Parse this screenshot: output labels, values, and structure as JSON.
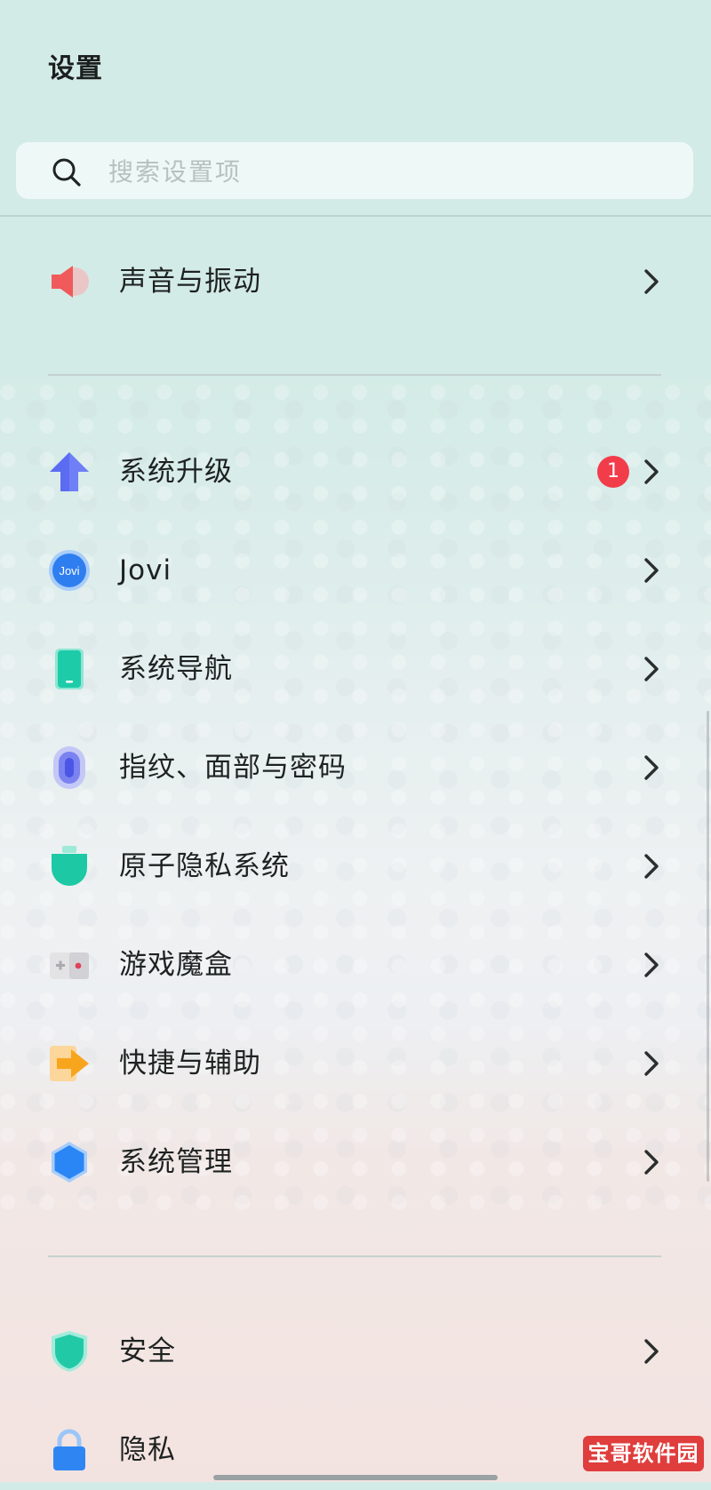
{
  "header": {
    "title": "设置"
  },
  "search": {
    "placeholder": "搜索设置项",
    "icon": "search-icon"
  },
  "items": [
    {
      "label": "声音与振动",
      "icon": "speaker-icon"
    },
    {
      "label": "系统升级",
      "icon": "upgrade-arrow-icon",
      "badge": "1"
    },
    {
      "label": "Jovi",
      "icon": "jovi-icon",
      "icon_text": "Jovi"
    },
    {
      "label": "系统导航",
      "icon": "phone-navigation-icon"
    },
    {
      "label": "指纹、面部与密码",
      "icon": "fingerprint-icon"
    },
    {
      "label": "原子隐私系统",
      "icon": "atomic-privacy-icon"
    },
    {
      "label": "游戏魔盒",
      "icon": "game-box-icon"
    },
    {
      "label": "快捷与辅助",
      "icon": "shortcut-arrow-icon"
    },
    {
      "label": "系统管理",
      "icon": "system-management-icon"
    },
    {
      "label": "安全",
      "icon": "shield-icon"
    },
    {
      "label": "隐私",
      "icon": "lock-icon"
    }
  ],
  "watermark": "宝哥软件园",
  "colors": {
    "badge": "#f23c4a",
    "sound_icon": "#f05a5a",
    "upgrade_icon": "#5b6cf2",
    "jovi_icon": "#2f7ef0",
    "navigation_icon": "#1ecba8",
    "fingerprint_icon": "#7a83ef",
    "atomic_privacy_icon": "#1cc9a4",
    "shortcut_icon": "#f8a51e",
    "system_management_icon": "#2a86f5",
    "security_icon": "#22c9a7",
    "lock_icon": "#2f86f3"
  }
}
